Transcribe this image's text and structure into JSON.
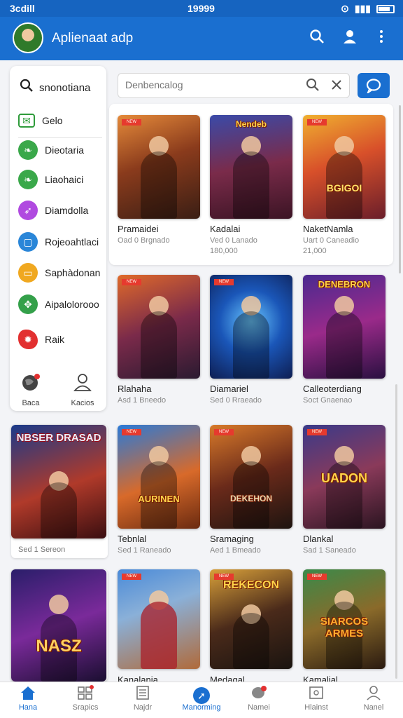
{
  "status_bar": {
    "left": "3cdill",
    "time": "19999"
  },
  "app_bar": {
    "title": "Aplienaat adp"
  },
  "sidebar": {
    "search_label": "snonotiana",
    "items": [
      {
        "label": "Gelo",
        "icon": "mail-icon",
        "color": "#2e9b3a"
      },
      {
        "label": "Dieotaria",
        "icon": "leaf-icon",
        "color": "#3aa84a"
      },
      {
        "label": "Liaohaici",
        "icon": "leaf-icon",
        "color": "#3aa84a"
      },
      {
        "label": "Diamdolla",
        "icon": "rocket-icon",
        "color": "#b04ae0"
      },
      {
        "label": "Rojeoahtlaci",
        "icon": "screen-icon",
        "color": "#2a86d8"
      },
      {
        "label": "Saphàdonan",
        "icon": "window-icon",
        "color": "#f0a820"
      },
      {
        "label": "Aipalolorooo",
        "icon": "puzzle-icon",
        "color": "#34a04a"
      },
      {
        "label": "Raik",
        "icon": "gear-icon",
        "color": "#e23030"
      }
    ],
    "bottom": [
      {
        "label": "Baca",
        "icon": "globe-icon"
      },
      {
        "label": "Kacios",
        "icon": "person-icon"
      }
    ]
  },
  "search": {
    "placeholder": "Denbencalog"
  },
  "cards": [
    {
      "title": "Pramaidei",
      "sub": "Oad 0 Brgnado",
      "num": "",
      "logo": ""
    },
    {
      "title": "Kadalai",
      "sub": "Ved 0 Lanado",
      "num": "180,000",
      "logo": "Nendeb"
    },
    {
      "title": "NaketNamla",
      "sub": "Uart 0 Caneadio",
      "num": "21,000",
      "logo": "BGIGOI"
    },
    {
      "title": "Rlahaha",
      "sub": "Asd 1 Bneedo",
      "num": "",
      "logo": ""
    },
    {
      "title": "Diamariel",
      "sub": "Sed 0 Rraeado",
      "num": "",
      "logo": ""
    },
    {
      "title": "Calleoterdiang",
      "sub": "Soct Gnaenao",
      "num": "",
      "logo": "DENEBRON"
    },
    {
      "title": "Tebnlal",
      "sub": "Sed 1 Raneado",
      "num": "",
      "logo": "AURINEN"
    },
    {
      "title": "Sramaging",
      "sub": "Aed 1 Bmeado",
      "num": "",
      "logo": "DEKEHON"
    },
    {
      "title": "Dlankal",
      "sub": "Sad 1 Saneado",
      "num": "",
      "logo": "UADON"
    },
    {
      "title": "Kanalania",
      "sub": "",
      "num": "",
      "logo": ""
    },
    {
      "title": "Medagal",
      "sub": "",
      "num": "",
      "logo": "REKECON"
    },
    {
      "title": "Kamalial",
      "sub": "",
      "num": "",
      "logo": "SIARCOS ARMES"
    }
  ],
  "featured": [
    {
      "logo": "NBSER DRASAD",
      "sub": "Sed 1 Sereon"
    },
    {
      "logo": "NASZ",
      "sub": ""
    }
  ],
  "bottom_nav": [
    {
      "label": "Hana",
      "icon": "home-icon"
    },
    {
      "label": "Srapics",
      "icon": "grid-icon"
    },
    {
      "label": "Najdr",
      "icon": "doc-icon"
    },
    {
      "label": "Manorming",
      "icon": "compass-icon"
    },
    {
      "label": "Namei",
      "icon": "chat-icon"
    },
    {
      "label": "Hlainst",
      "icon": "album-icon"
    },
    {
      "label": "Nanel",
      "icon": "profile-icon"
    }
  ],
  "colors": {
    "primary": "#1a6fd0",
    "accent": "#e63a2e"
  }
}
